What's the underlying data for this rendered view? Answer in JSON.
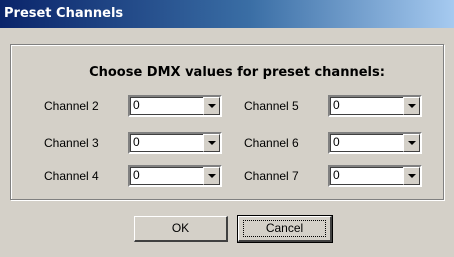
{
  "window": {
    "title": "Preset Channels"
  },
  "group": {
    "heading": "Choose DMX values for preset channels:"
  },
  "channels_left": [
    {
      "label": "Channel 2",
      "value": "0"
    },
    {
      "label": "Channel 3",
      "value": "0"
    },
    {
      "label": "Channel 4",
      "value": "0"
    }
  ],
  "channels_right": [
    {
      "label": "Channel 5",
      "value": "0"
    },
    {
      "label": "Channel 6",
      "value": "0"
    },
    {
      "label": "Channel 7",
      "value": "0"
    }
  ],
  "buttons": {
    "ok": "OK",
    "cancel": "Cancel"
  },
  "colors": {
    "titlebar_start": "#0a246a",
    "titlebar_end": "#a6caf0",
    "dialog_bg": "#d4d0c8"
  }
}
